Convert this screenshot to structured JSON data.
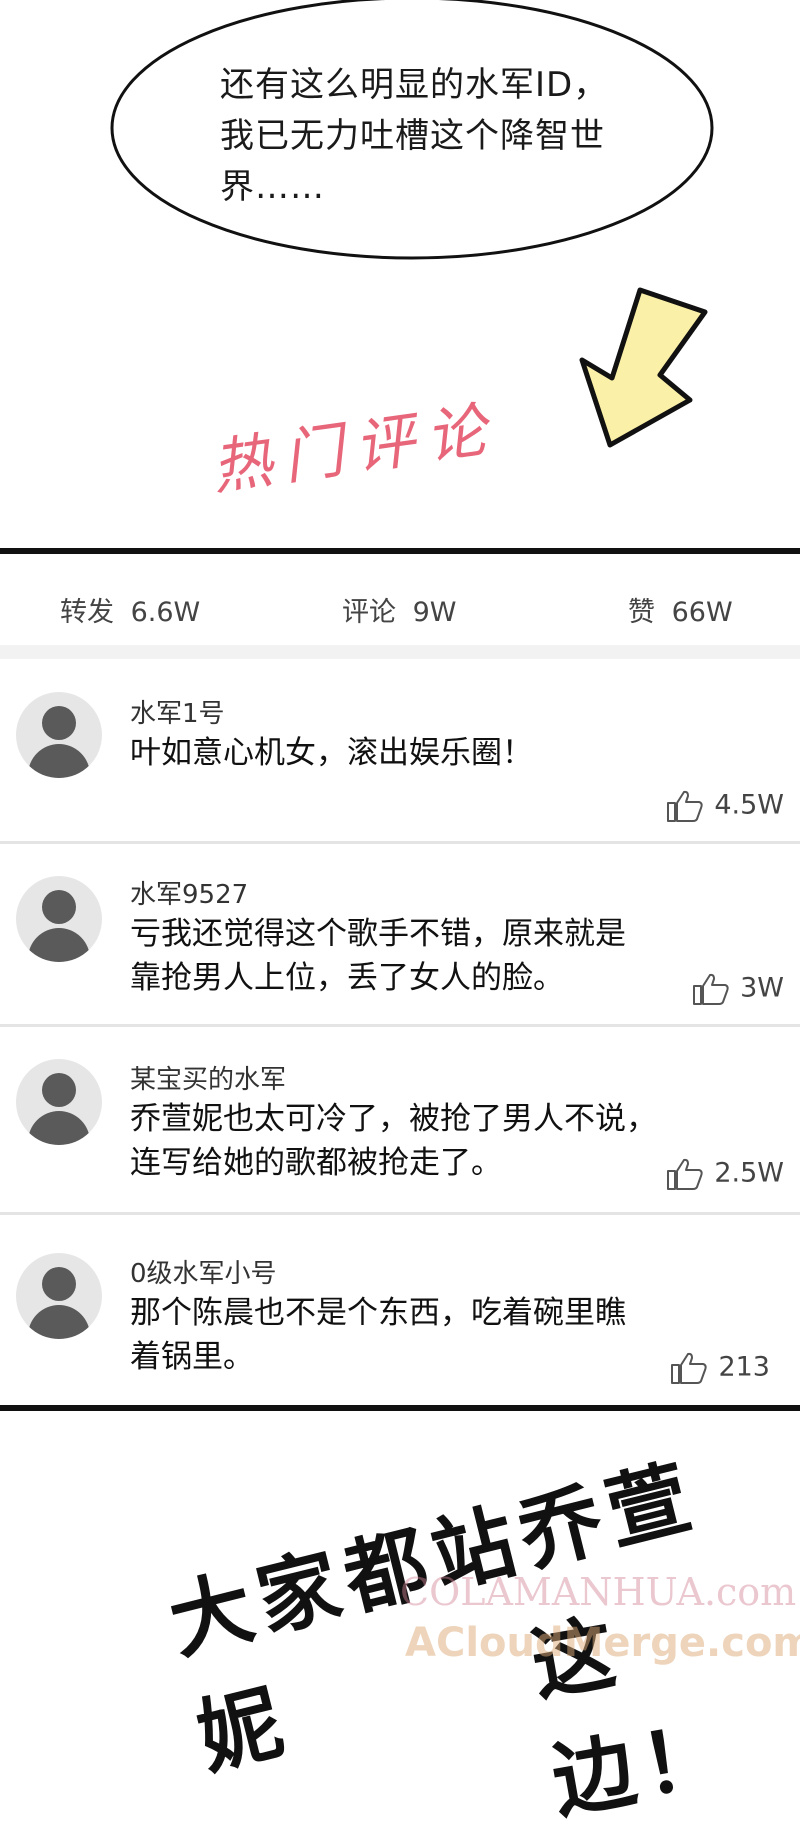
{
  "speech_bubble": {
    "lines": [
      "还有这么明显的水军ID，",
      "我已无力吐槽这个降智世",
      "界……"
    ]
  },
  "hot_comments_label": "热门评论",
  "stats": {
    "repost_label": "转发",
    "repost_value": "6.6W",
    "comment_label": "评论",
    "comment_value": "9W",
    "like_label": "赞",
    "like_value": "66W"
  },
  "comments": [
    {
      "user": "水军1号",
      "lines": [
        "叶如意心机女，滚出娱乐圈！"
      ],
      "likes": "4.5W"
    },
    {
      "user": "水军9527",
      "lines": [
        "亏我还觉得这个歌手不错，原来就是",
        "靠抢男人上位，丢了女人的脸。"
      ],
      "likes": "3W"
    },
    {
      "user": "某宝买的水军",
      "lines": [
        "乔萱妮也太可冷了，被抢了男人不说，",
        "连写给她的歌都被抢走了。"
      ],
      "likes": "2.5W"
    },
    {
      "user": "0级水军小号",
      "lines": [
        "那个陈晨也不是个东西，吃着碗里瞧",
        "着锅里。"
      ],
      "likes": "213"
    }
  ],
  "bottom_caption": [
    "大家都站乔萱妮",
    "这边！"
  ],
  "watermarks": [
    "COLAMANHUA.com",
    "ACloudMerge.com"
  ],
  "colors": {
    "handwriting_pink": "#e8667a",
    "arrow_yellow": "#fbf0a8",
    "divider": "#e4e4e4"
  },
  "icons": {
    "arrow": "down-left-arrow-icon",
    "thumb": "thumbs-up-icon",
    "avatar": "default-avatar-icon"
  }
}
